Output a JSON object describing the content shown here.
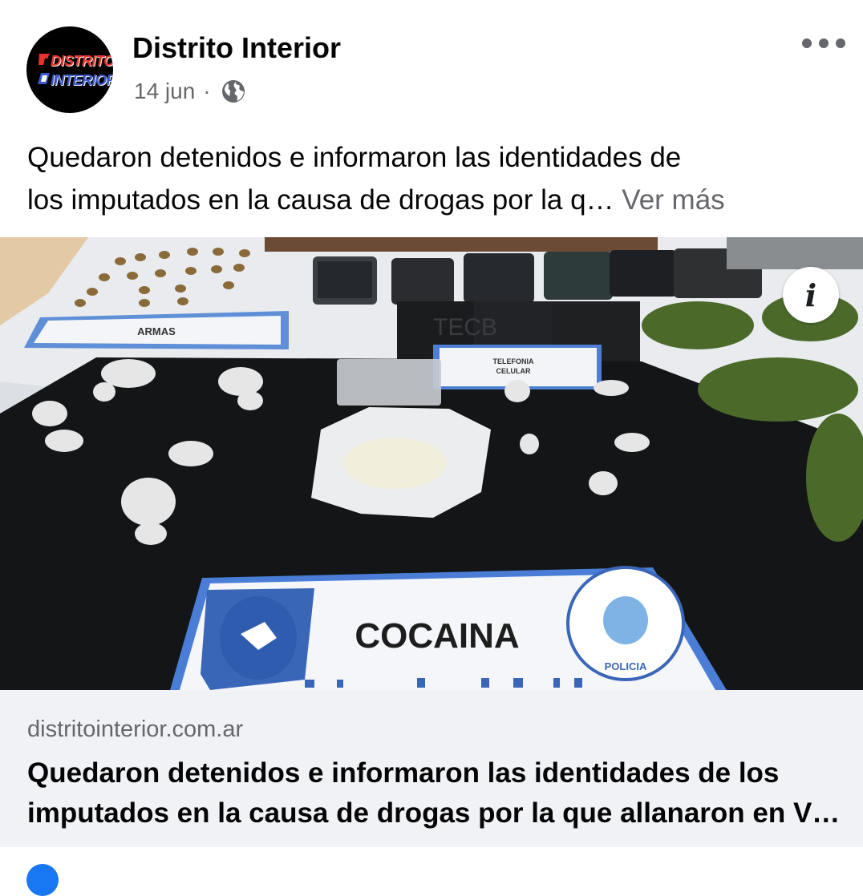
{
  "post": {
    "page_name": "Distrito Interior",
    "avatar_logo": [
      "DISTRITO",
      "INTERIOR"
    ],
    "date": "14 jun",
    "separator": "·",
    "privacy_icon": "globe-icon",
    "more_icon": "more-horizontal-icon",
    "caption_lines": [
      "Quedaron detenidos e informaron las identidades de",
      "los imputados en la causa de drogas por la q…"
    ],
    "see_more": "Ver más"
  },
  "photo": {
    "info_icon": "info-icon",
    "info_label": "i",
    "labels": {
      "armas": "ARMAS",
      "telefonia_1": "TELEFONIA",
      "telefonia_2": "CELULAR",
      "cocaina": "COCAINA",
      "policia": "POLICIA"
    }
  },
  "link_preview": {
    "domain": "distritointerior.com.ar",
    "title_lines": [
      "Quedaron detenidos e informaron las identidades de los",
      "imputados en la causa de drogas por la que allanaron en V…"
    ]
  },
  "colors": {
    "text_primary": "#050505",
    "text_secondary": "#65676b",
    "link_bg": "#f0f2f5",
    "accent_blue": "#1877f2"
  }
}
